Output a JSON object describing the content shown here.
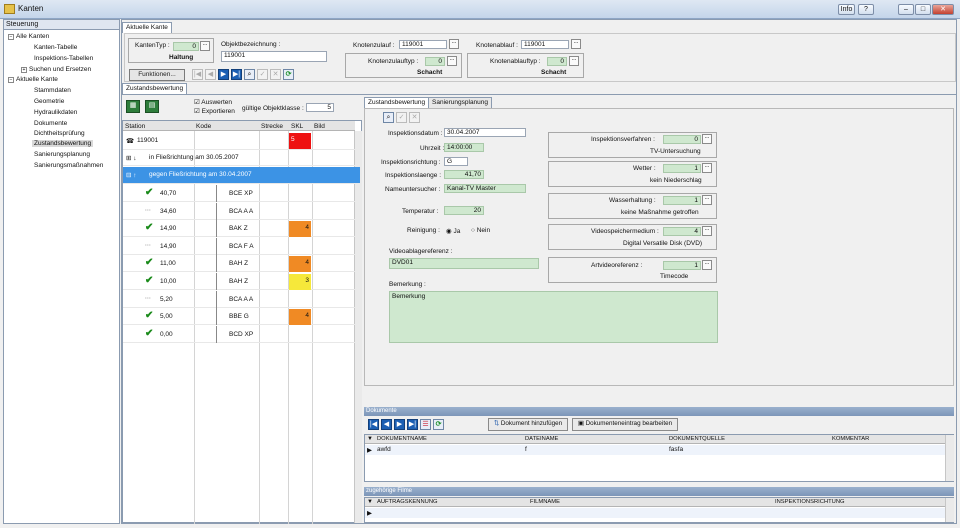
{
  "window": {
    "title": "Kanten",
    "info_label": "Info",
    "help_label": "?"
  },
  "tree": {
    "header": "Steuerung",
    "items": [
      {
        "label": "Alle Kanten",
        "expander": "−"
      },
      {
        "label": "Kanten-Tabelle"
      },
      {
        "label": "Inspektions-Tabellen"
      },
      {
        "label": "Suchen und Ersetzen",
        "expander": "+"
      },
      {
        "label": "Aktuelle Kante",
        "expander": "−"
      },
      {
        "label": "Stammdaten"
      },
      {
        "label": "Geometrie"
      },
      {
        "label": "Hydraulikdaten"
      },
      {
        "label": "Dokumente"
      },
      {
        "label": "Dichtheitsprüfung"
      },
      {
        "label": "Zustandsbewertung"
      },
      {
        "label": "Sanierungsplanung"
      },
      {
        "label": "Sanierungsmaßnahmen"
      }
    ]
  },
  "main_tab": "Aktuelle Kante",
  "header": {
    "kantentyp_label": "KantenTyp :",
    "kantentyp_value": "0",
    "kantentyp_name": "Haltung",
    "objekt_label": "Objektbezeichnung :",
    "objekt_value": "119001",
    "funktionen_label": "Funktionen...",
    "knotenzulauf_label": "Knotenzulauf :",
    "knotenzulauf_value": "119001",
    "knotenzulauftyp_label": "Knotenzulauftyp :",
    "knotenzulauftyp_value": "0",
    "knotenzulauftyp_name": "Schacht",
    "knotenablauf_label": "Knotenablauf :",
    "knotenablauf_value": "119001",
    "knotenablauftyp_label": "Knotenablauftyp :",
    "knotenablauftyp_value": "0",
    "knotenablauftyp_name": "Schacht",
    "dots": "..."
  },
  "zustand_tab": "Zustandsbewertung",
  "left_panel": {
    "auswerten": "Auswerten",
    "exportieren": "Exportieren",
    "objektklasse_label": "gültige Objektklasse :",
    "objektklasse_value": "5",
    "columns": [
      "Station",
      "Kode",
      "Strecke",
      "SKL",
      "Bild"
    ],
    "root_label": "119001",
    "root_skl": "5",
    "insp1": "in Fließrichtung am 30.05.2007",
    "insp2": "gegen Fließrichtung am 30.04.2007",
    "rows": [
      {
        "station": "40,70",
        "kode": "BCE XP",
        "skl": "",
        "check": true
      },
      {
        "station": "34,60",
        "kode": "BCA A A",
        "skl": "",
        "check": false
      },
      {
        "station": "14,90",
        "kode": "BAK Z",
        "skl": "4",
        "check": true
      },
      {
        "station": "14,90",
        "kode": "BCA F A",
        "skl": "",
        "check": false
      },
      {
        "station": "11,00",
        "kode": "BAH Z",
        "skl": "4",
        "check": true
      },
      {
        "station": "10,00",
        "kode": "BAH Z",
        "skl": "3",
        "check": true
      },
      {
        "station": "5,20",
        "kode": "BCA A A",
        "skl": "",
        "check": false
      },
      {
        "station": "5,00",
        "kode": "BBE G",
        "skl": "4",
        "check": true
      },
      {
        "station": "0,00",
        "kode": "BCD XP",
        "skl": "",
        "check": true
      }
    ]
  },
  "right_tabs": [
    "Zustandsbewertung",
    "Sanierungsplanung"
  ],
  "form": {
    "inspektionsdatum_label": "Inspektionsdatum :",
    "inspektionsdatum_value": "30.04.2007",
    "uhrzeit_label": "Uhrzeit :",
    "uhrzeit_value": "14:00:00",
    "richtung_label": "Inspektionsrichtung :",
    "richtung_value": "G",
    "laenge_label": "Inspektionslaenge :",
    "laenge_value": "41,70",
    "untersucher_label": "Nameuntersucher :",
    "untersucher_value": "Kanal-TV Master",
    "temperatur_label": "Temperatur :",
    "temperatur_value": "20",
    "reinigung_label": "Reinigung :",
    "ja_label": "Ja",
    "nein_label": "Nein",
    "video_label": "Videoablagereferenz :",
    "video_value": "DVD01",
    "bemerkung_label": "Bemerkung :",
    "bemerkung_value": "Bemerkung",
    "verfahren_label": "Inspektionsverfahren :",
    "verfahren_value": "0",
    "verfahren_name": "TV-Untersuchung",
    "wetter_label": "Wetter :",
    "wetter_value": "1",
    "wetter_name": "kein Niederschlag",
    "wasser_label": "Wasserhaltung :",
    "wasser_value": "1",
    "wasser_name": "keine Maßnahme getroffen",
    "medium_label": "Videospeichermedium :",
    "medium_value": "4",
    "medium_name": "Digital Versatile Disk (DVD)",
    "artvideo_label": "Artvideoreferenz :",
    "artvideo_value": "1",
    "artvideo_name": "Timecode"
  },
  "dokumente": {
    "title": "Dokumente",
    "add_label": "Dokument hinzufügen",
    "edit_label": "Dokumenteneintrag bearbeiten",
    "columns": [
      "DOKUMENTNAME",
      "DATEINAME",
      "DOKUMENTQUELLE",
      "KOMMENTAR"
    ],
    "rows": [
      {
        "name": "awfd",
        "file": "f",
        "source": "fasfa",
        "comment": ""
      }
    ]
  },
  "filme": {
    "title": "zugehörige Filme",
    "columns": [
      "AUFTRAGSKENNUNG",
      "FILMNAME",
      "INSPEKTIONSRICHTUNG"
    ]
  }
}
